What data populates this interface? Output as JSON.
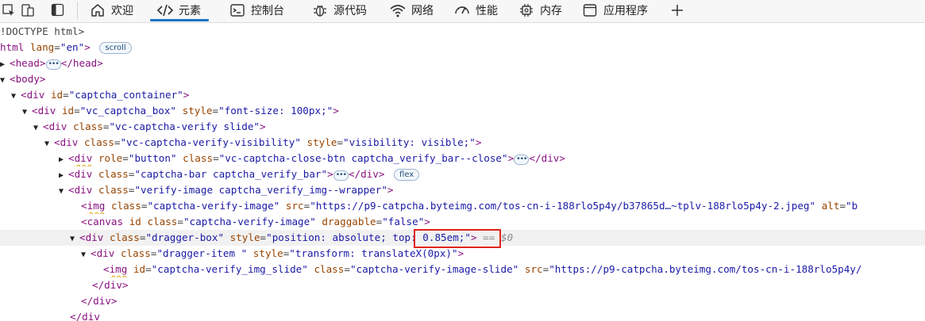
{
  "toolbar": {
    "tabs": [
      {
        "label": "欢迎",
        "icon": "home-icon"
      },
      {
        "label": "元素",
        "icon": "code-icon",
        "active": true
      },
      {
        "label": "控制台",
        "icon": "console-icon"
      },
      {
        "label": "源代码",
        "icon": "bug-icon"
      },
      {
        "label": "网络",
        "icon": "wifi-icon"
      },
      {
        "label": "性能",
        "icon": "gauge-icon"
      },
      {
        "label": "内存",
        "icon": "chip-icon"
      },
      {
        "label": "应用程序",
        "icon": "window-icon"
      }
    ],
    "add_icon": "plus-icon"
  },
  "tree": {
    "doctype": "!DOCTYPE html>",
    "html": {
      "tag": "html",
      "attr": "lang",
      "val": "\"en\"",
      "badge": "scroll"
    },
    "head": {
      "open": "<head>",
      "close": "</head>"
    },
    "body": "<body>",
    "captcha_container": {
      "tag": "div",
      "attr": "id",
      "val": "\"captcha_container\""
    },
    "vc_captcha_box": {
      "tag": "div",
      "attr1": "id",
      "val1": "\"vc_captcha_box\"",
      "attr2": "style",
      "val2": "\"font-size: 100px;\""
    },
    "verify_slide": {
      "tag": "div",
      "attr": "class",
      "val": "\"vc-captcha-verify slide\""
    },
    "visibility": {
      "tag": "div",
      "attr1": "class",
      "val1": "\"vc-captcha-verify-visibility\"",
      "attr2": "style",
      "val2": "\"visibility: visible;\""
    },
    "close_btn": {
      "tag": "div",
      "attr1": "role",
      "val1": "\"button\"",
      "attr2": "class",
      "val2": "\"vc-captcha-close-btn captcha_verify_bar--close\"",
      "close": "</div>"
    },
    "captcha_bar": {
      "tag": "div",
      "attr": "class",
      "val": "\"captcha-bar captcha_verify_bar\"",
      "close": "</div>",
      "badge": "flex"
    },
    "verify_image": {
      "tag": "div",
      "attr": "class",
      "val": "\"verify-image captcha_verify_img--wrapper\""
    },
    "img1": {
      "tag": "img",
      "attr1": "class",
      "val1": "\"captcha-verify-image\"",
      "attr2": "src",
      "val2": "\"https://p9-catpcha.byteimg.com/tos-cn-i-188rlo5p4y/b37865d…~tplv-188rlo5p4y-2.jpeg\"",
      "attr3": "alt",
      "val3": "\"b"
    },
    "canvas": {
      "tag": "canvas",
      "attr1": "id",
      "attr2": "class",
      "val2": "\"captcha-verify-image\"",
      "attr3": "draggable",
      "val3": "\"false\""
    },
    "dragger_box": {
      "tag": "div",
      "attr1": "class",
      "val1": "\"dragger-box\"",
      "attr2": "style",
      "val2a": "\"position: absolute;",
      "val2b": "top: 0.85em;",
      "val2c": "\"",
      "eq": "== $0"
    },
    "dragger_item": {
      "tag": "div",
      "attr1": "class",
      "val1": "\"dragger-item \"",
      "attr2": "style",
      "val2": "\"transform: translateX(0px)\""
    },
    "img2": {
      "tag": "img",
      "attr1": "id",
      "val1": "\"captcha-verify_img_slide\"",
      "attr2": "class",
      "val2": "\"captcha-verify-image-slide\"",
      "attr3": "src",
      "val3": "\"https://p9-catpcha.byteimg.com/tos-cn-i-188rlo5p4y/"
    },
    "close_div": "</div>",
    "close_div_partial": "</div"
  }
}
